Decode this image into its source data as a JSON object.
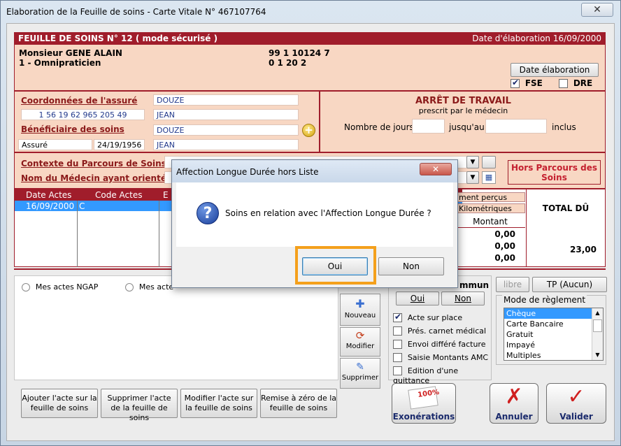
{
  "window": {
    "title": "Elaboration de la Feuille de soins - Carte Vitale N° 467107764",
    "close_glyph": "✕"
  },
  "header": {
    "title": "FEUILLE DE SOINS  N° 12 ( mode sécurisé )",
    "date": "Date d'élaboration 16/09/2000"
  },
  "doctor": {
    "name": "Monsieur GENE ALAIN",
    "specialty": "1 - Omnipraticien",
    "id_line1": "99 1 10124 7",
    "id_line2": "0 1 20 2",
    "date_button": "Date élaboration",
    "fse_label": "FSE",
    "dre_label": "DRE"
  },
  "insured": {
    "coord_label": "Coordonnées de l'assuré",
    "nir": "1 56 19 62 965 205 49",
    "name": "DOUZE",
    "firstname": "JEAN",
    "benef_label": "Bénéficiaire des soins",
    "benef_name": "DOUZE",
    "benef_type": "Assuré",
    "benef_dob": "24/19/1956",
    "benef_firstname": "JEAN"
  },
  "arret": {
    "title": "ARRÊT DE TRAVAIL",
    "subtitle": "prescrit par le médecin",
    "days_label": "Nombre de jours",
    "until_label": "jusqu'au",
    "inclus_label": "inclus"
  },
  "parcours": {
    "context_label": "Contexte du Parcours de Soins",
    "medecin_label": "Nom du Médecin ayant orienté",
    "hors_parcours": "Hors Parcours des Soins"
  },
  "grid": {
    "col_date": "Date Actes",
    "col_code": "Code Actes",
    "col_e": "E",
    "row_date": "16/09/2000",
    "row_code": "C"
  },
  "totals": {
    "label_percus": "ment perçus",
    "label_km": "Kilométriques",
    "label_montant": "Montant",
    "total_label": "TOTAL DÛ",
    "values": [
      "0,00",
      "0,00",
      "0,00"
    ],
    "total_value": "23,00"
  },
  "lower": {
    "radio1": "Mes actes NGAP",
    "radio2": "Mes acte",
    "commun_label": "mmun",
    "oui": "Oui",
    "non": "Non",
    "libre": "libre",
    "tp": "TP (Aucun)",
    "mode_label": "Mode de règlement",
    "modes": [
      "Chèque",
      "Carte Bancaire",
      "Gratuit",
      "Impayé",
      "Multiples"
    ],
    "checks": [
      "Acte sur place",
      "Prés. carnet médical",
      "Envoi différé facture",
      "Saisie Montants AMC",
      "Edition d'une quittance"
    ],
    "side_buttons": [
      "Nouveau",
      "Modifier",
      "Supprimer"
    ],
    "bottom_buttons": [
      "Ajouter l'acte sur la feuille de soins",
      "Supprimer l'acte de la feuille de soins",
      "Modifier l'acte sur la feuille de soins",
      "Remise à zéro de la feuille de soins"
    ],
    "big_buttons": [
      "Exonérations",
      "Annuler",
      "Valider"
    ],
    "exo_badge": "100%"
  },
  "dialog": {
    "title": "Affection Longue Durée hors Liste",
    "message": "Soins en relation avec l'Affection Longue Durée ?",
    "oui": "Oui",
    "non": "Non",
    "icon_glyph": "?"
  }
}
